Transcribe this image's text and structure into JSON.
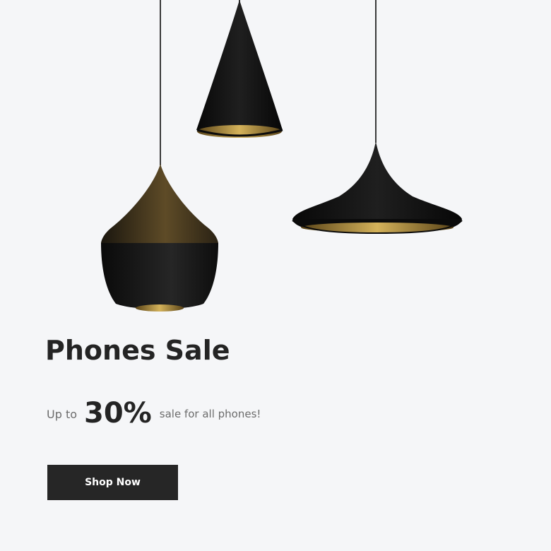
{
  "banner": {
    "title": "Phones Sale",
    "offer": {
      "prefix": "Up to",
      "percent": "30%",
      "suffix": "sale for all phones!"
    },
    "button_label": "Shop Now",
    "image_icon": "pendant-lamps-image"
  },
  "colors": {
    "background": "#f5f6f8",
    "button": "#262626",
    "heading": "#242424",
    "muted_text": "#6c6c6c",
    "lamp_black": "#121212",
    "lamp_gold": "#9a7a2e"
  }
}
